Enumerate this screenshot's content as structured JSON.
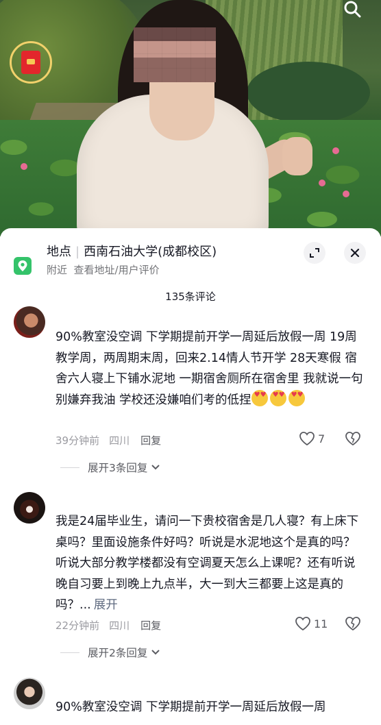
{
  "location": {
    "label": "地点",
    "name": "西南石油大学(成都校区)",
    "subtitle": "附近  查看地址/用户评价"
  },
  "comment_count": "135条评论",
  "comments": [
    {
      "text": "90%教室没空调 下学期提前开学一周延后放假一周 19周教学周，两周期末周，回来2.14情人节开学 28天寒假 宿舍六人寝上下铺水泥地 一期宿舍厕所在宿舍里   我就说一句 别嫌弃我油 学校还没嫌咱们考的低捏",
      "emoji_count": 3,
      "time": "39分钟前",
      "region": "四川",
      "reply": "回复",
      "likes": "7",
      "expand_replies": "展开3条回复"
    },
    {
      "text": "我是24届毕业生，请问一下贵校宿舍是几人寝？有上床下桌吗？里面设施条件好吗？听说是水泥地这个是真的吗？听说大部分教学楼都没有空调夏天怎么上课呢？还有听说晚自习要上到晚上九点半，大一到大三都要上这是真的吗？...",
      "expand_inline": "展开",
      "time": "22分钟前",
      "region": "四川",
      "reply": "回复",
      "likes": "11",
      "expand_replies": "展开2条回复"
    },
    {
      "text": "90%教室没空调 下学期提前开学一周延后放假一周"
    }
  ],
  "colors": {
    "text": "#161823",
    "muted": "#9a9aa0",
    "location_icon": "#34c36a",
    "red_packet": "#e3262c"
  }
}
